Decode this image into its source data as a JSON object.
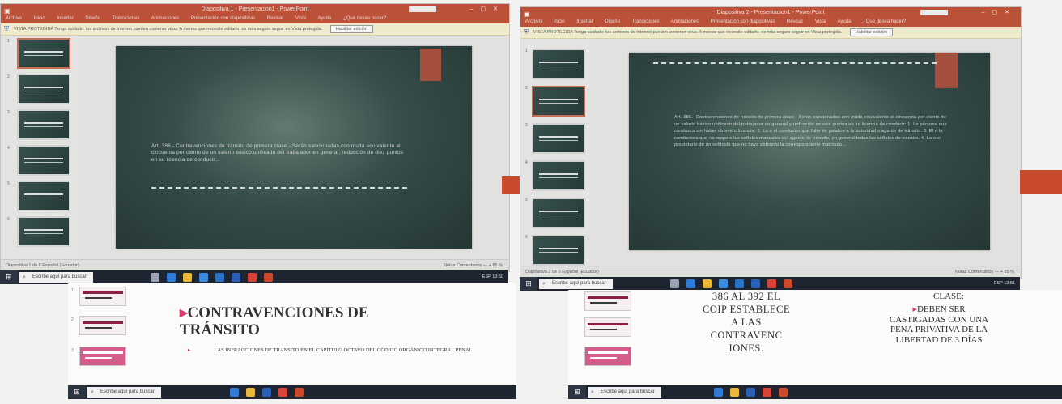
{
  "window_left": {
    "title": "Diapositiva 1 - Presentacion1 - PowerPoint",
    "menu": [
      "Archivo",
      "Inicio",
      "Insertar",
      "Diseño",
      "Transiciones",
      "Animaciones",
      "Presentación con diapositivas",
      "Revisar",
      "Vista",
      "Ayuda",
      "¿Qué desea hacer?"
    ],
    "warning": "VISTA PROTEGIDA  Tenga cuidado: los archivos de Internet pueden contener virus. A menos que necesite editarlo, es más seguro seguir en Vista protegida.",
    "enable_label": "Habilitar edición",
    "thumb_numbers": [
      "1",
      "2",
      "3",
      "4",
      "5",
      "6"
    ],
    "slide_text": "Art. 386.- Contravenciones de tránsito de primera clase.- Serán sancionadas con multa equivalente al cincuenta por ciento de un salario básico unificado del trabajador en general, reducción de diez puntos en su licencia de conducir…",
    "status": "Diapositiva 1 de 6    Español (Ecuador)",
    "zoom": "Notas   Comentarios   —  +  85 %",
    "search_placeholder": "Escribe aquí para buscar",
    "tray": "ESP  13:50"
  },
  "window_right": {
    "title": "Diapositiva 2 - Presentacion1 - PowerPoint",
    "menu": [
      "Archivo",
      "Inicio",
      "Insertar",
      "Diseño",
      "Transiciones",
      "Animaciones",
      "Presentación con diapositivas",
      "Revisar",
      "Vista",
      "Ayuda",
      "¿Qué desea hacer?"
    ],
    "warning": "VISTA PROTEGIDA  Tenga cuidado: los archivos de Internet pueden contener virus. A menos que necesite editarlo, es más seguro seguir en Vista protegida.",
    "enable_label": "Habilitar edición",
    "thumb_numbers": [
      "1",
      "2",
      "3",
      "4",
      "5",
      "6"
    ],
    "slide_text": "Art. 386.- Contravenciones de tránsito de primera clase.- Serán sancionadas con multa equivalente al cincuenta por ciento de un salario básico unificado del trabajador en general y reducción de seis puntos en su licencia de conducir: 1. La persona que conduzca sin haber obtenido licencia. 2. La o el conductor que falte de palabra a la autoridad o agente de tránsito. 3. El o la conductora que no respete las señales manuales del agente de tránsito, en general todas las señales de tránsito. 4. La o el propietario de un vehículo que no haya obtenido la correspondiente matrícula…",
    "status": "Diapositiva 2 de 6    Español (Ecuador)",
    "zoom": "Notas   Comentarios   —  +  85 %",
    "search_placeholder": "Escribe aquí para buscar",
    "tray": "ESP  13:51"
  },
  "panel_left": {
    "thumb_numbers": [
      "1",
      "2",
      "3"
    ],
    "title": "CONTRAVENCIONES DE TRÁNSITO",
    "bullet": "LAS INFRACCIONES DE TRÁNSITO EN EL CAPÍTULO OCTAVO DEL CÓDIGO ORGÁNICO INTEGRAL PENAL",
    "search_placeholder": "Escribe aquí para buscar"
  },
  "panel_right": {
    "thumb_numbers": [
      "1",
      "2",
      "3"
    ],
    "left_col": "386 AL 392 EL COIP ESTABLECE A LAS CONTRAVENC IONES.",
    "right_top": "CLASE:",
    "right_col": "DEBEN SER CASTIGADAS CON UNA PENA PRIVATIVA DE LA LIBERTAD DE 3 DÍAS",
    "search_placeholder": "Escribe aquí para buscar"
  },
  "colors": {
    "powerpoint_red": "#c94a2c",
    "slide_dark_green": "#2d4945",
    "accent_pink": "#d43c6b",
    "taskbar": "#1f2530"
  }
}
